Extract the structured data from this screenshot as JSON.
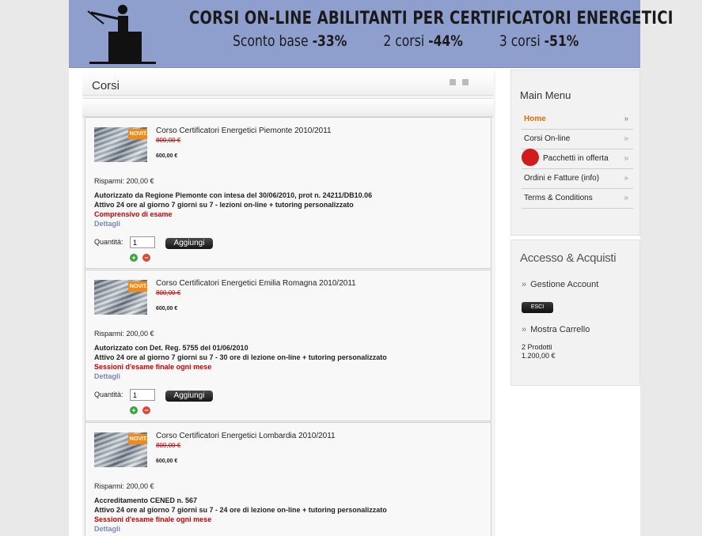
{
  "banner": {
    "title": "CORSI ON-LINE ABILITANTI PER CERTIFICATORI ENERGETICI",
    "offer1_label": "Sconto base",
    "offer1_pct": "-33%",
    "offer2_label": "2 corsi",
    "offer2_pct": "-44%",
    "offer3_label": "3 corsi",
    "offer3_pct": "-51%"
  },
  "main": {
    "title": "Corsi",
    "products": [
      {
        "badge": "NOVITÀ",
        "name": "Corso Certificatori Energetici Piemonte 2010/2011",
        "old_price": "800,00 €",
        "new_price": "600,00 €",
        "savings": "Risparmi: 200,00 €",
        "desc1": "Autorizzato da Regione Piemonte con intesa del 30/06/2010, prot n. 24211/DB10.06",
        "desc2": "Attivo 24 ore al giorno 7 giorni su 7 - lezioni on-line + tutoring personalizzato",
        "note": "Comprensivo di esame",
        "details": "Dettagli",
        "qty_label": "Quantità:",
        "qty_value": "1",
        "add_label": "Aggiungi"
      },
      {
        "badge": "NOVITÀ",
        "name": "Corso Certificatori Energetici Emilia Romagna 2010/2011",
        "old_price": "800,00 €",
        "new_price": "600,00 €",
        "savings": "Risparmi: 200,00 €",
        "desc1": "Autorizzato con Det. Reg. 5755 del 01/06/2010",
        "desc2": "Attivo 24 ore al giorno 7 giorni su 7 - 30 ore di lezione on-line + tutoring personalizzato",
        "note": "Sessioni d'esame finale ogni mese",
        "details": "Dettagli",
        "qty_label": "Quantità:",
        "qty_value": "1",
        "add_label": "Aggiungi"
      },
      {
        "badge": "NOVITÀ",
        "name": "Corso Certificatori Energetici Lombardia 2010/2011",
        "old_price": "800,00 €",
        "new_price": "600,00 €",
        "savings": "Risparmi: 200,00 €",
        "desc1": "Accreditamento CENED n. 567",
        "desc2": "Attivo 24 ore al giorno 7 giorni su 7 - 24 ore di lezione on-line + tutoring personalizzato",
        "note": "Sessioni d'esame finale ogni mese",
        "details": "Dettagli"
      }
    ]
  },
  "sidebar": {
    "menu_title": "Main Menu",
    "menu": [
      {
        "label": "Home",
        "arrow": "»"
      },
      {
        "label": "Corsi On-line",
        "arrow": "»"
      },
      {
        "label": "Pacchetti in offerta",
        "arrow": "»"
      },
      {
        "label": "Ordini e Fatture (info)",
        "arrow": "»"
      },
      {
        "label": "Terms & Conditions",
        "arrow": "»"
      }
    ],
    "account_title": "Accesso & Acquisti",
    "account_link": "Gestione Account",
    "logout_label": "ESCI",
    "cart_link": "Mostra Carrello",
    "cart_count": "2 Prodotti",
    "cart_total": "1.200,00 €",
    "chev": "»"
  },
  "colors": {
    "banner_bg": "#8e9ecd",
    "active_menu": "#e06b00",
    "old_price": "#cc0000",
    "note_red": "#cc0000",
    "details_link": "#7888b6"
  }
}
